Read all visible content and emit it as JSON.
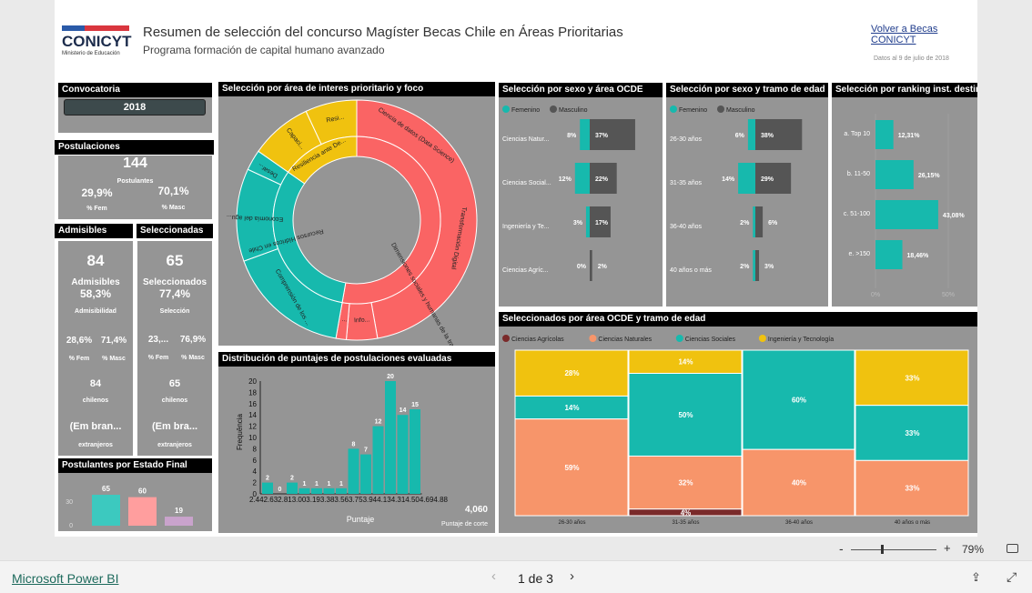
{
  "header": {
    "logo": "CONICYT",
    "logo_sub": "Ministerio de Educación",
    "title": "Resumen de selección del concurso Magíster Becas Chile en Áreas Prioritarias",
    "subtitle": "Programa formación de capital humano avanzado",
    "back_link": "Volver a Becas CONICYT",
    "date": "Datos al 9 de julio de 2018"
  },
  "convocatoria": {
    "title": "Convocatoria",
    "value": "2018"
  },
  "postulaciones": {
    "title": "Postulaciones",
    "count": "144",
    "count_label": "Postulantes",
    "fem": "29,9%",
    "fem_label": "% Fem",
    "masc": "70,1%",
    "masc_label": "% Masc"
  },
  "admisibles": {
    "title": "Admisibles",
    "count": "84",
    "count_label": "Admisibles",
    "pct": "58,3%",
    "pct_label": "Admisibilidad",
    "fem": "28,6%",
    "masc": "71,4%",
    "fem_label": "% Fem",
    "masc_label": "% Masc",
    "chilenos": "84",
    "chilenos_label": "chilenos",
    "extranjeros": "(Em bran...",
    "extranjeros_label": "extranjeros"
  },
  "seleccionadas": {
    "title": "Seleccionadas",
    "count": "65",
    "count_label": "Seleccionados",
    "pct": "77,4%",
    "pct_label": "Selección",
    "fem": "23,...",
    "masc": "76,9%",
    "fem_label": "% Fem",
    "masc_label": "% Masc",
    "chilenos": "65",
    "chilenos_label": "chilenos",
    "extranjeros": "(Em bra...",
    "extranjeros_label": "extranjeros"
  },
  "estado_final": {
    "title": "Postulantes por Estado Final",
    "yticks": [
      "30",
      "0"
    ],
    "bars": [
      {
        "value": 65,
        "label": "65",
        "color": "#3cc9bf"
      },
      {
        "value": 60,
        "label": "60",
        "color": "#ff9e9e"
      },
      {
        "value": 19,
        "label": "19",
        "color": "#c9a3cc"
      }
    ]
  },
  "sunburst": {
    "title": "Selección por área de interes prioritario y foco",
    "inner": [
      "Recursos Hídricos en Chile",
      "Economía del agu...",
      "Desar...",
      "Capaci...",
      "Resi...",
      "Ciencia de datos (Data Science)"
    ],
    "outer": [
      "Transformación Digital",
      "Dimensiones sociales y humanas de la tra...",
      "Info...",
      "...",
      "Comprensión de los ...",
      "Resiliencia ante De..."
    ]
  },
  "sexo_area": {
    "title": "Selección por sexo y área OCDE",
    "legend": [
      "Femenino",
      "Masculino"
    ],
    "rows": [
      {
        "label": "Ciencias Natur...",
        "fem": "8%",
        "masc": "37%",
        "f": 8,
        "m": 37
      },
      {
        "label": "Ciencias Social...",
        "fem": "12%",
        "masc": "22%",
        "f": 12,
        "m": 22
      },
      {
        "label": "Ingeniería y Te...",
        "fem": "3%",
        "masc": "17%",
        "f": 3,
        "m": 17
      },
      {
        "label": "Ciencias Agríc...",
        "fem": "0%",
        "masc": "2%",
        "f": 0,
        "m": 2
      }
    ]
  },
  "sexo_edad": {
    "title": "Selección por sexo y tramo de edad",
    "legend": [
      "Femenino",
      "Masculino"
    ],
    "rows": [
      {
        "label": "26-30 años",
        "fem": "6%",
        "masc": "38%",
        "f": 6,
        "m": 38
      },
      {
        "label": "31-35 años",
        "fem": "14%",
        "masc": "29%",
        "f": 14,
        "m": 29
      },
      {
        "label": "36-40 años",
        "fem": "2%",
        "masc": "6%",
        "f": 2,
        "m": 6
      },
      {
        "label": "40 años o más",
        "fem": "2%",
        "masc": "3%",
        "f": 2,
        "m": 3
      }
    ]
  },
  "ranking": {
    "title": "Selección por ranking inst. destino",
    "rows": [
      {
        "label": "a. Top 10",
        "value": "12,31%",
        "v": 12.31
      },
      {
        "label": "b. 11-50",
        "value": "26,15%",
        "v": 26.15
      },
      {
        "label": "c. 51-100",
        "value": "43,08%",
        "v": 43.08
      },
      {
        "label": "e. >150",
        "value": "18,46%",
        "v": 18.46
      }
    ],
    "axis": [
      "0%",
      "50%"
    ]
  },
  "hist": {
    "title": "Distribución de puntajes de postulaciones evaluadas",
    "ylabel": "Frequência",
    "xlabel": "Puntaje",
    "xticks": "2.442.632.813.003.193.383.563.753.944.134.314.504.694.88",
    "cut_value": "4,060",
    "cut_label": "Puntaje de corte",
    "yticks": [
      "20",
      "18",
      "16",
      "14",
      "12",
      "10",
      "8",
      "6",
      "4",
      "2",
      "0"
    ],
    "values": [
      2,
      0,
      2,
      1,
      1,
      1,
      1,
      8,
      7,
      12,
      20,
      14,
      15
    ]
  },
  "mosaic": {
    "title": "Seleccionados por área OCDE y tramo de edad",
    "legend": [
      {
        "name": "Ciencias Agrícolas",
        "color": "#7a2a2a"
      },
      {
        "name": "Ciencias Naturales",
        "color": "#f7956a"
      },
      {
        "name": "Ciencias Sociales",
        "color": "#17b9ad"
      },
      {
        "name": "Ingeniería y Tecnología",
        "color": "#f0c20f"
      }
    ],
    "columns": [
      {
        "label": "26-30 años",
        "cells": [
          {
            "label": "28%",
            "color": "#f0c20f"
          },
          {
            "label": "14%",
            "color": "#17b9ad"
          },
          {
            "label": "59%",
            "color": "#f7956a"
          }
        ]
      },
      {
        "label": "31-35 años",
        "cells": [
          {
            "label": "14%",
            "color": "#f0c20f"
          },
          {
            "label": "50%",
            "color": "#17b9ad"
          },
          {
            "label": "32%",
            "color": "#f7956a"
          },
          {
            "label": "4%",
            "color": "#7a2a2a"
          }
        ]
      },
      {
        "label": "36-40 años",
        "cells": [
          {
            "label": "60%",
            "color": "#17b9ad"
          },
          {
            "label": "40%",
            "color": "#f7956a"
          }
        ]
      },
      {
        "label": "40 años o más",
        "cells": [
          {
            "label": "33%",
            "color": "#f0c20f"
          },
          {
            "label": "33%",
            "color": "#17b9ad"
          },
          {
            "label": "33%",
            "color": "#f7956a"
          }
        ]
      }
    ]
  },
  "footer": {
    "zoom": "79%",
    "zoom_minus": "-",
    "zoom_plus": "+",
    "brand": "Microsoft Power BI",
    "page": "1 de 3"
  }
}
